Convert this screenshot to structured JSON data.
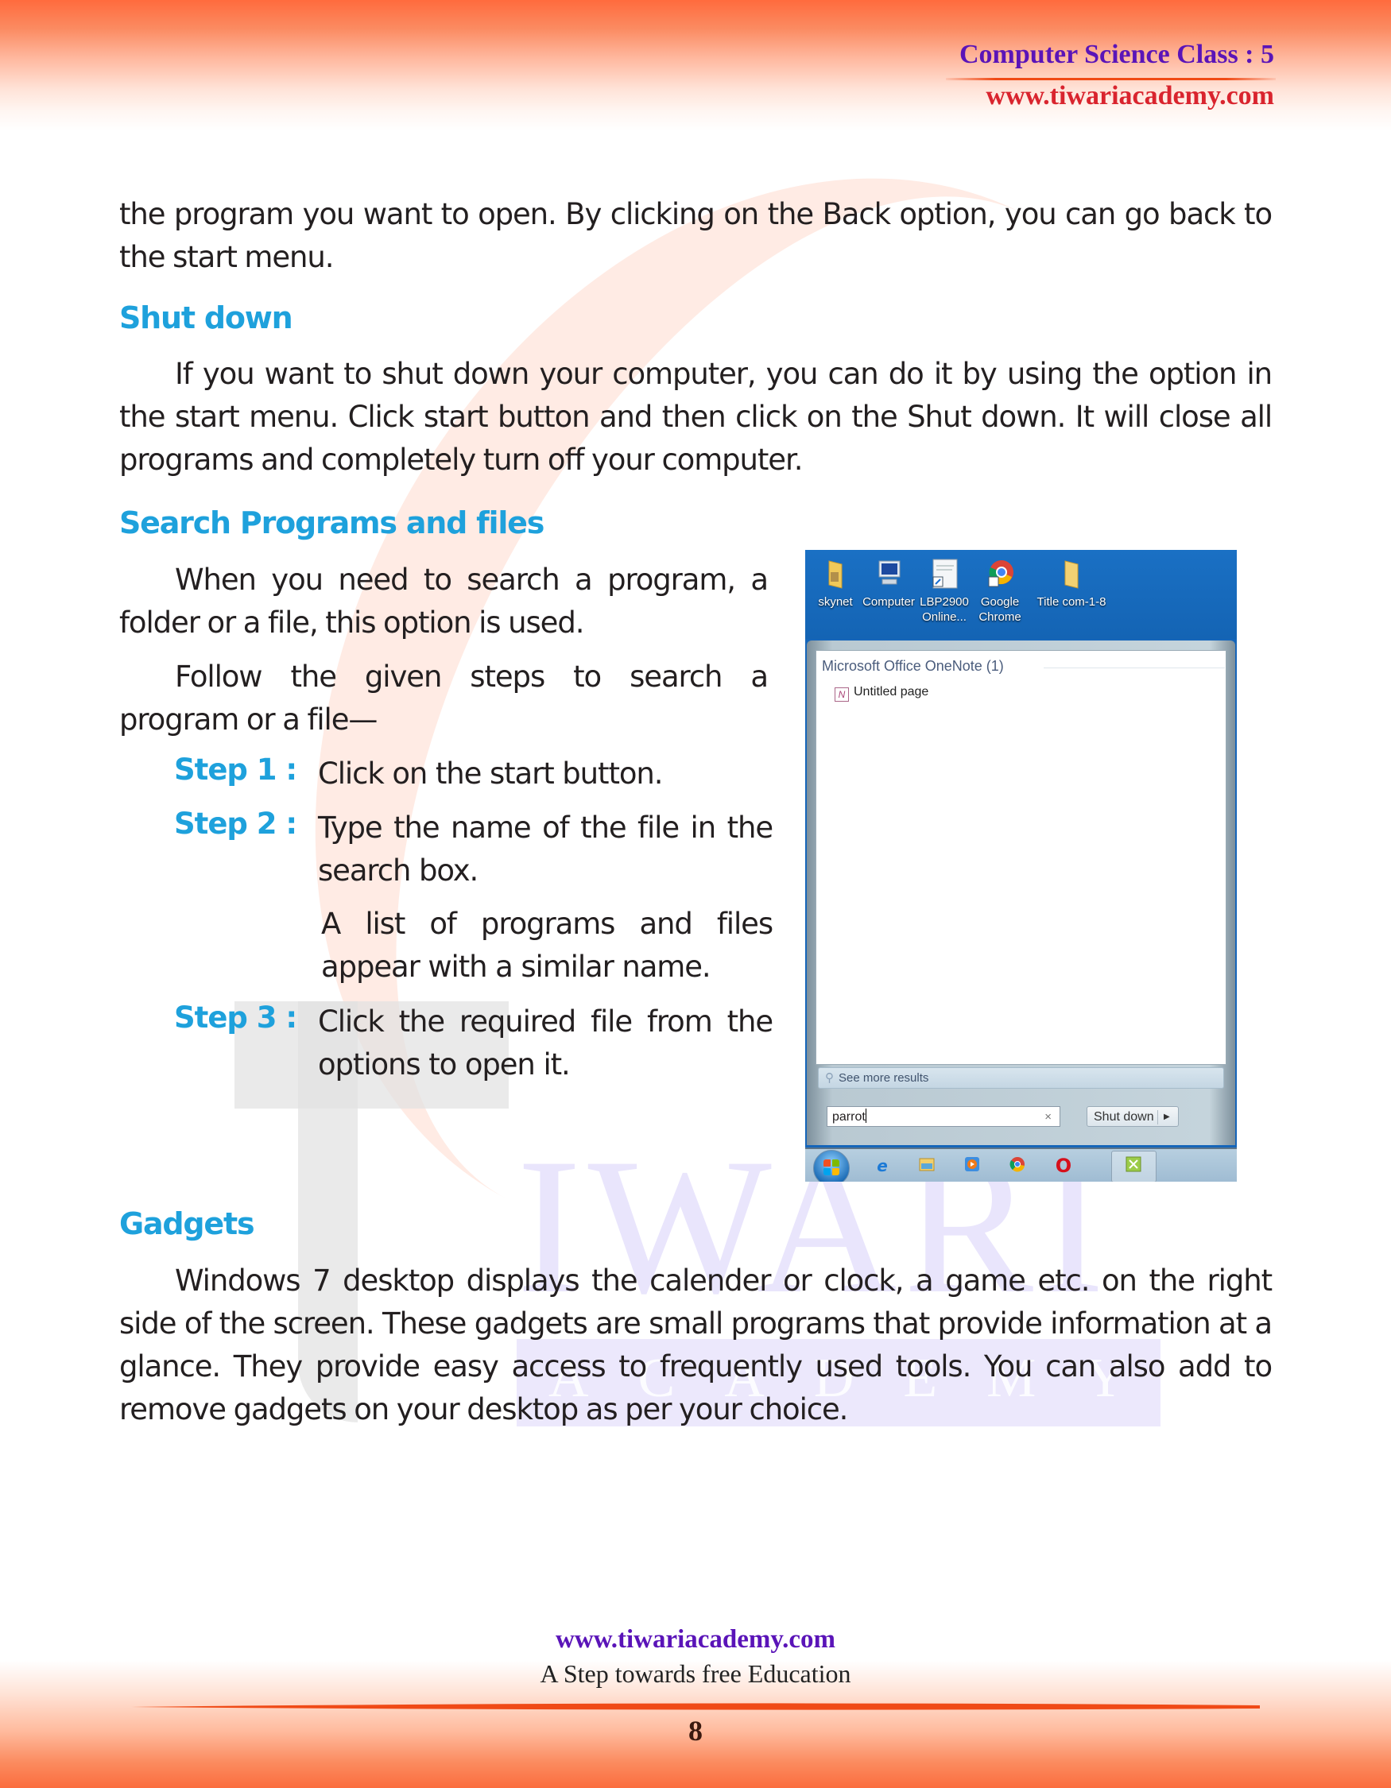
{
  "header": {
    "title": "Computer Science Class : 5",
    "url": "www.tiwariacademy.com"
  },
  "watermark": {
    "word": "IWARI",
    "subword": "ACADEMY"
  },
  "body": {
    "intro_paragraph": "the program you want to open. By clicking on the Back option, you can go back to the start menu.",
    "shutdown": {
      "heading": "Shut down",
      "paragraph": "If you want to shut down your computer, you can do it by using the option in the start menu. Click start button and then click on the Shut down. It will close all programs and completely turn off your computer."
    },
    "search": {
      "heading": "Search Programs and files",
      "paragraph1": "When you need to search a program, a folder or a file, this option is used.",
      "paragraph2": "Follow the given steps to search a program or a file—",
      "steps": [
        {
          "label": "Step 1  :",
          "text": "Click on the start button."
        },
        {
          "label": "Step 2  :",
          "text": "Type the name of the file in the search box.",
          "note": "A list of programs and files appear with a similar name."
        },
        {
          "label": "Step 3  :",
          "text": "Click the required file from the options to open it."
        }
      ]
    },
    "gadgets": {
      "heading": "Gadgets",
      "paragraph": "Windows 7 desktop displays the calender or clock, a game etc. on the right side of the screen. These gadgets are small programs that provide information at a glance. They provide easy access to frequently used tools. You can also add to remove gadgets on your desktop as per your choice."
    }
  },
  "screenshot": {
    "desktop_icons": [
      {
        "label": "skynet",
        "icon": "folder-icon"
      },
      {
        "label": "Computer",
        "icon": "computer-icon"
      },
      {
        "label": "LBP2900 Online...",
        "icon": "shortcut-document-icon"
      },
      {
        "label": "Google Chrome",
        "icon": "chrome-icon"
      },
      {
        "label": "Title com-1-8",
        "icon": "folder-icon"
      }
    ],
    "result_group": "Microsoft Office OneNote (1)",
    "result_item": "Untitled page",
    "see_more": "See more results",
    "search_value": "parrot",
    "clear_glyph": "×",
    "shutdown_label": "Shut down",
    "shutdown_arrow": "▶",
    "taskbar_icons": [
      "start-orb-icon",
      "internet-explorer-icon",
      "file-explorer-icon",
      "media-player-icon",
      "chrome-icon",
      "opera-icon",
      "snipping-tool-icon"
    ],
    "colors": {
      "desktop": "#1565b9",
      "taskbar": "#aec7da"
    }
  },
  "footer": {
    "url": "www.tiwariacademy.com",
    "tagline": "A Step towards free Education",
    "page_number": "8"
  },
  "colors": {
    "heading": "#1ea1dc",
    "header_title": "#5a14b8",
    "header_url": "#d9242e",
    "band": "#ff6b3d"
  }
}
